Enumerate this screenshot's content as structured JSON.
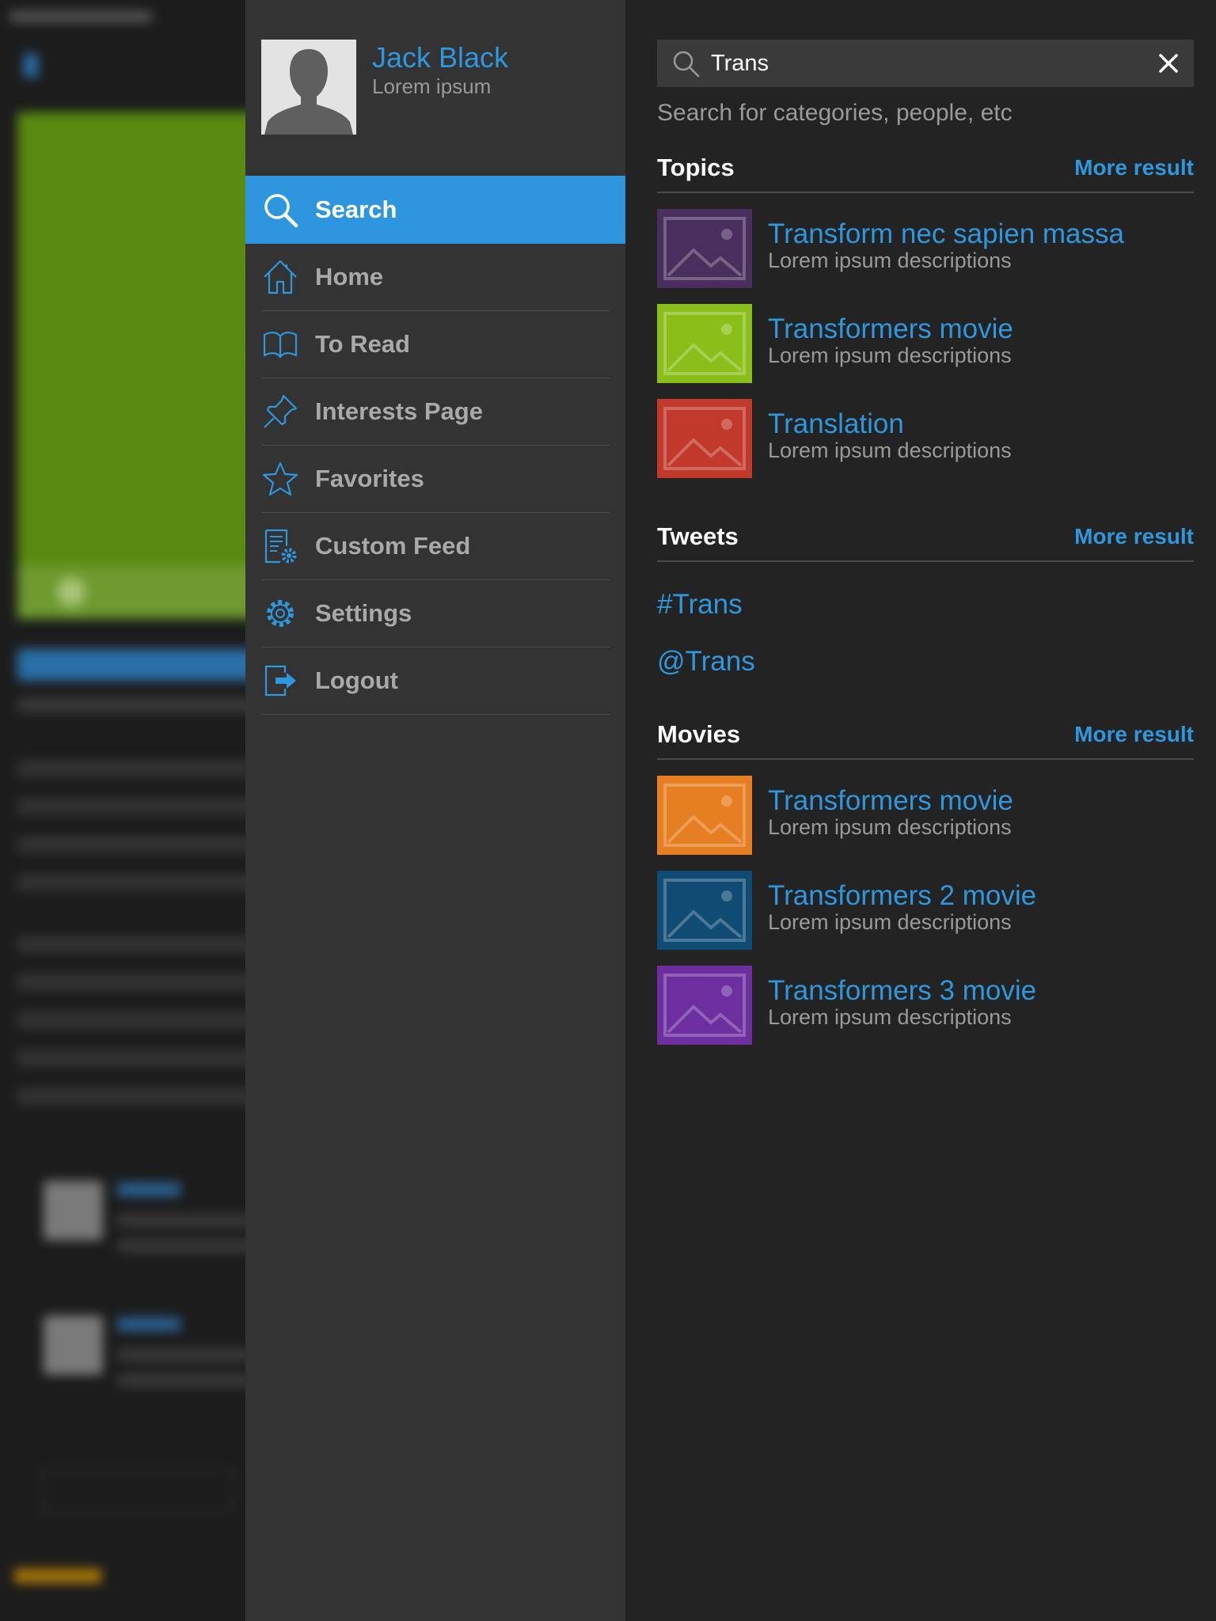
{
  "user": {
    "name": "Jack Black",
    "subtitle": "Lorem ipsum"
  },
  "nav": [
    {
      "label": "Search",
      "icon": "search-icon",
      "active": true
    },
    {
      "label": "Home",
      "icon": "home-icon",
      "active": false
    },
    {
      "label": "To Read",
      "icon": "book-icon",
      "active": false
    },
    {
      "label": "Interests Page",
      "icon": "pin-icon",
      "active": false
    },
    {
      "label": "Favorites",
      "icon": "star-icon",
      "active": false
    },
    {
      "label": "Custom Feed",
      "icon": "feed-settings-icon",
      "active": false
    },
    {
      "label": "Settings",
      "icon": "gear-icon",
      "active": false
    },
    {
      "label": "Logout",
      "icon": "logout-icon",
      "active": false
    }
  ],
  "search": {
    "value": "Trans",
    "hint": "Search for categories, people, etc"
  },
  "topics": {
    "title": "Topics",
    "more": "More result",
    "items": [
      {
        "title": "Transform nec sapien massa",
        "desc": "Lorem ipsum descriptions",
        "color": "#4a2f5e",
        "icon": "image-icon"
      },
      {
        "title": "Transformers movie",
        "desc": "Lorem ipsum descriptions",
        "color": "#8abf1a",
        "icon": "image-icon"
      },
      {
        "title": "Translation",
        "desc": "Lorem ipsum descriptions",
        "color": "#c0392b",
        "icon": "image-icon"
      }
    ]
  },
  "tweets": {
    "title": "Tweets",
    "more": "More result",
    "items": [
      "#Trans",
      "@Trans"
    ]
  },
  "movies": {
    "title": "Movies",
    "more": "More result",
    "items": [
      {
        "title": "Transformers movie",
        "desc": "Lorem ipsum descriptions",
        "color": "#e67e22",
        "icon": "image-icon"
      },
      {
        "title": "Transformers 2 movie",
        "desc": "Lorem ipsum descriptions",
        "color": "#0f4b73",
        "icon": "image-icon"
      },
      {
        "title": "Transformers 3 movie",
        "desc": "Lorem ipsum descriptions",
        "color": "#6d2fa0",
        "icon": "image-icon"
      }
    ]
  },
  "colors": {
    "accent": "#2e97dd",
    "drawer_bg": "#333333",
    "panel_bg": "#232323"
  }
}
